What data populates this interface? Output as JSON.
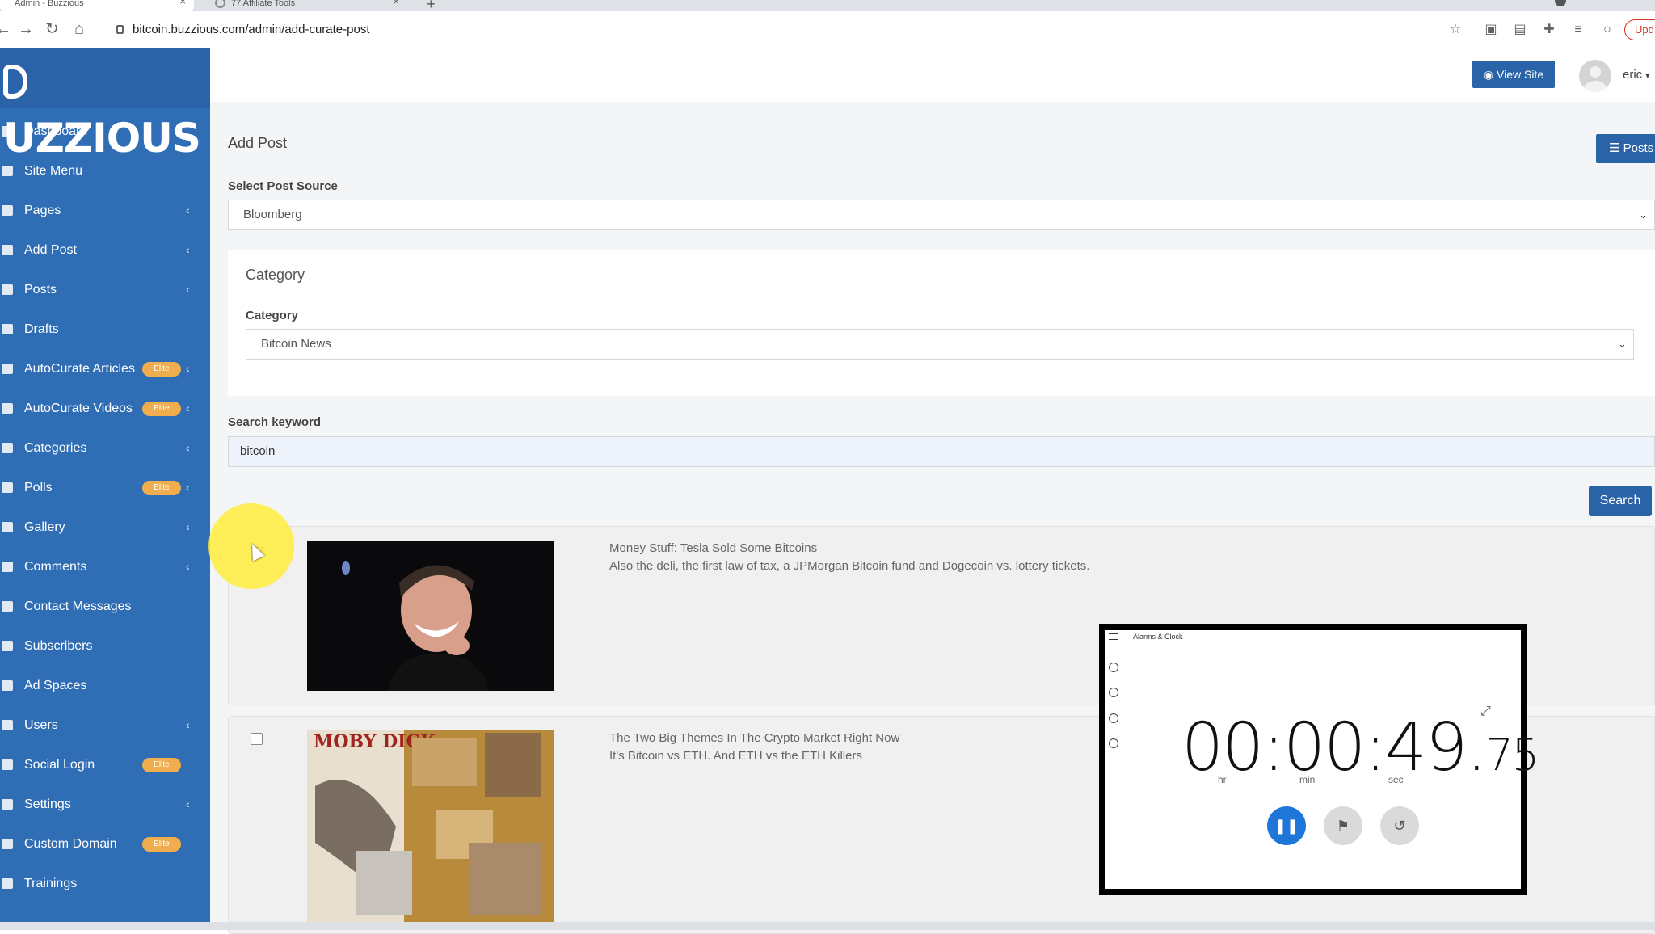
{
  "browser": {
    "active_tab_title": "Admin - Buzzious",
    "inactive_tab_title": "77 Affiliate Tools",
    "url": "bitcoin.buzzious.com/admin/add-curate-post",
    "update_label": "Upd"
  },
  "brand": {
    "logo_text": "UZZIOUS"
  },
  "header": {
    "view_site_label": "View Site",
    "username": "eric"
  },
  "sidebar": {
    "items": [
      {
        "label": "Dashboard",
        "chevron": false,
        "elite": false
      },
      {
        "label": "Site Menu",
        "chevron": false,
        "elite": false
      },
      {
        "label": "Pages",
        "chevron": true,
        "elite": false
      },
      {
        "label": "Add Post",
        "chevron": true,
        "elite": false
      },
      {
        "label": "Posts",
        "chevron": true,
        "elite": false
      },
      {
        "label": "Drafts",
        "chevron": false,
        "elite": false
      },
      {
        "label": "AutoCurate Articles",
        "chevron": true,
        "elite": true
      },
      {
        "label": "AutoCurate Videos",
        "chevron": true,
        "elite": true
      },
      {
        "label": "Categories",
        "chevron": true,
        "elite": false
      },
      {
        "label": "Polls",
        "chevron": true,
        "elite": true
      },
      {
        "label": "Gallery",
        "chevron": true,
        "elite": false
      },
      {
        "label": "Comments",
        "chevron": true,
        "elite": false
      },
      {
        "label": "Contact Messages",
        "chevron": false,
        "elite": false
      },
      {
        "label": "Subscribers",
        "chevron": false,
        "elite": false
      },
      {
        "label": "Ad Spaces",
        "chevron": false,
        "elite": false
      },
      {
        "label": "Users",
        "chevron": true,
        "elite": false
      },
      {
        "label": "Social Login",
        "chevron": false,
        "elite": true
      },
      {
        "label": "Settings",
        "chevron": true,
        "elite": false
      },
      {
        "label": "Custom Domain",
        "chevron": false,
        "elite": true
      },
      {
        "label": "Trainings",
        "chevron": false,
        "elite": false
      }
    ],
    "elite_label": "Elite",
    "chevron_glyph": "‹"
  },
  "main": {
    "page_title": "Add Post",
    "posts_button_label": "Posts",
    "post_source_label": "Select Post Source",
    "post_source_value": "Bloomberg",
    "category_section_title": "Category",
    "category_label": "Category",
    "category_value": "Bitcoin News",
    "search_keyword_label": "Search keyword",
    "search_keyword_value": "bitcoin",
    "search_button_label": "Search",
    "results": [
      {
        "title": "Money Stuff: Tesla Sold Some Bitcoins",
        "description": "Also the deli, the first law of tax, a JPMorgan Bitcoin fund and Dogecoin vs. lottery tickets."
      },
      {
        "title": "The Two Big Themes In The Crypto Market Right Now",
        "description": "It's Bitcoin vs ETH. And ETH vs the ETH Killers"
      }
    ],
    "thumb2_text": "MOBY DICK"
  },
  "clock": {
    "window_title": "Alarms & Clock",
    "time_main": "00:00:49.",
    "time_ms": "75",
    "labels": {
      "hr": "hr",
      "min": "min",
      "sec": "sec"
    }
  }
}
